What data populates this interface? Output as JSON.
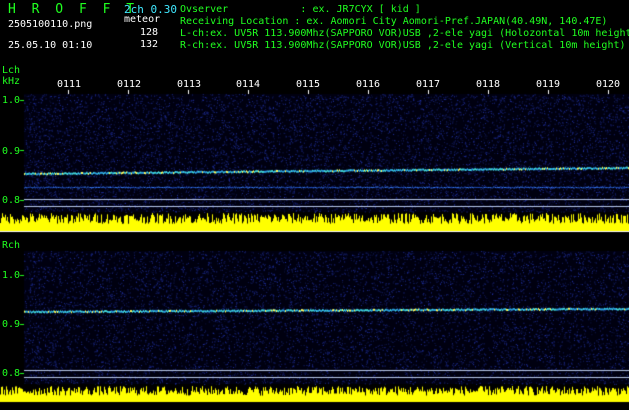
{
  "header": {
    "app_title": "H R O F F T",
    "version": "2ch 0.30",
    "filename": "2505100110.png",
    "mode": "meteor",
    "count_l": "128",
    "count_r": "132",
    "timestamp": "25.05.10 01:10",
    "observer_line": "Ovserver            : ex. JR7CYX [ kid ]",
    "location_line": "Receiving Location : ex. Aomori City Aomori-Pref.JAPAN(40.49N, 140.47E)",
    "lch_line": "L-ch:ex. UV5R 113.900Mhz(SAPPORO VOR)USB ,2-ele yagi (Holozontal 10m height)",
    "rch_line": "R-ch:ex. UV5R 113.900Mhz(SAPPORO VOR)USB ,2-ele yagi (Vertical 10m height)"
  },
  "lch": {
    "label": "Lch",
    "unit": "kHz",
    "ticks": [
      "1.0",
      "0.9",
      "0.8"
    ]
  },
  "rch": {
    "label": "Rch",
    "ticks": [
      "1.0",
      "0.9",
      "0.8"
    ]
  },
  "time_ticks": [
    "0111",
    "0112",
    "0113",
    "0114",
    "0115",
    "0116",
    "0117",
    "0118",
    "0119",
    "0120"
  ],
  "colors": {
    "background": "#000000",
    "text_green": "#20ff20",
    "text_white": "#ffffff",
    "text_cyan": "#40e8ff",
    "signal_line": "#3ccfcf",
    "level_yellow": "#ffff00",
    "noise_blue": "#2030a0"
  }
}
